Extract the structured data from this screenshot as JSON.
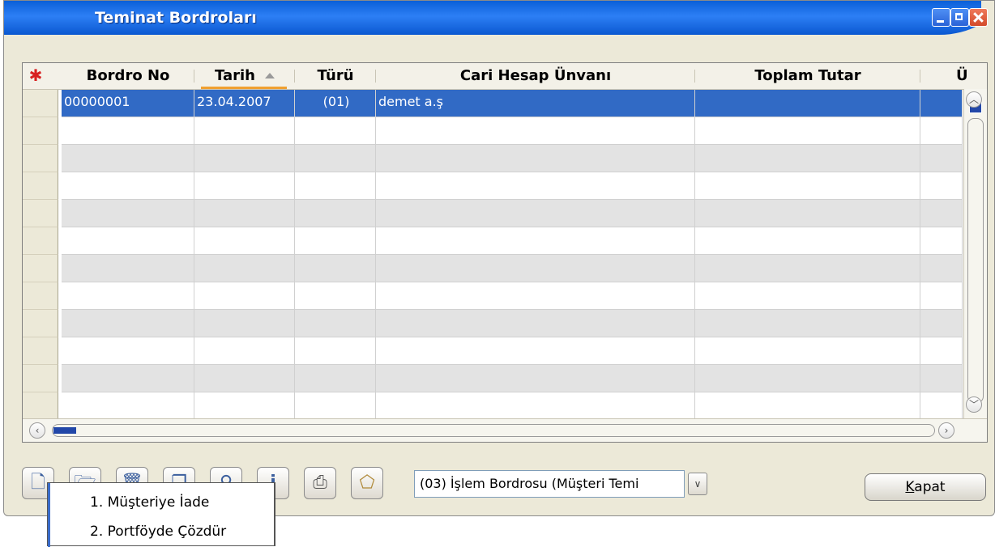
{
  "window": {
    "title": "Teminat Bordroları"
  },
  "grid": {
    "columns": [
      "Bordro No",
      "Tarih",
      "Türü",
      "Cari Hesap Ünvanı",
      "Toplam Tutar",
      "Ü"
    ],
    "rows": [
      [
        "00000001",
        "23.04.2007",
        "(01)",
        "demet a.ş",
        "",
        ""
      ]
    ],
    "sort_column": "Tarih"
  },
  "toolbar": {
    "buttons": [
      "new-icon",
      "open-icon",
      "delete-icon",
      "copy-icon",
      "search-icon",
      "info-icon",
      "print-icon",
      "filter-icon"
    ],
    "combo_value": "(03) İşlem Bordrosu (Müşteri Temi",
    "close_label": "apat",
    "close_mnemonic": "K"
  },
  "popup_menu": {
    "items": [
      "1. Müşteriye İade",
      "2. Portföyde Çözdür"
    ]
  },
  "colors": {
    "selection": "#316ac5",
    "titlebar": "#0a5fd8",
    "sort_indicator": "#f0a030"
  }
}
